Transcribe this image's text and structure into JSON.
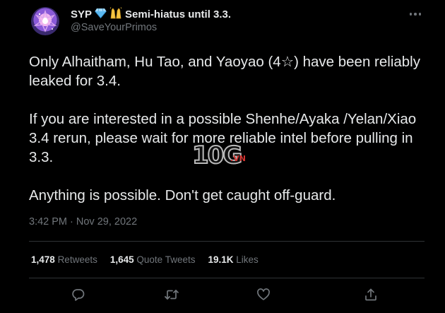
{
  "tweet": {
    "author_name": "SYP",
    "author_suffix": "Semi-hiatus until 3.3.",
    "author_emojis": [
      "gem-icon",
      "raised-hands-icon"
    ],
    "handle": "@SaveYourPrimos",
    "paragraphs": [
      "Only Alhaitham, Hu Tao, and Yaoyao (4☆) have been reliably leaked for 3.4.",
      "If you are interested in a possible Shenhe/Ayaka /Yelan/Xiao 3.4 rerun, please wait for more reliable intel before pulling in 3.3.",
      "Anything is possible. Don't get caught off-guard."
    ],
    "timestamp": "3:42 PM · Nov 29, 2022"
  },
  "stats": [
    {
      "count": "1,478",
      "label": "Retweets"
    },
    {
      "count": "1,645",
      "label": "Quote Tweets"
    },
    {
      "count": "19.1K",
      "label": "Likes"
    }
  ],
  "actions": [
    "reply-icon",
    "retweet-icon",
    "like-icon",
    "share-icon"
  ],
  "watermark": {
    "big": "10G",
    "small": ".VN"
  },
  "colors": {
    "background": "#000000",
    "text": "#e7e9ea",
    "muted": "#71767b",
    "divider": "#2f3336",
    "gem": "#5ab8f0",
    "hands": "#f5c542"
  }
}
